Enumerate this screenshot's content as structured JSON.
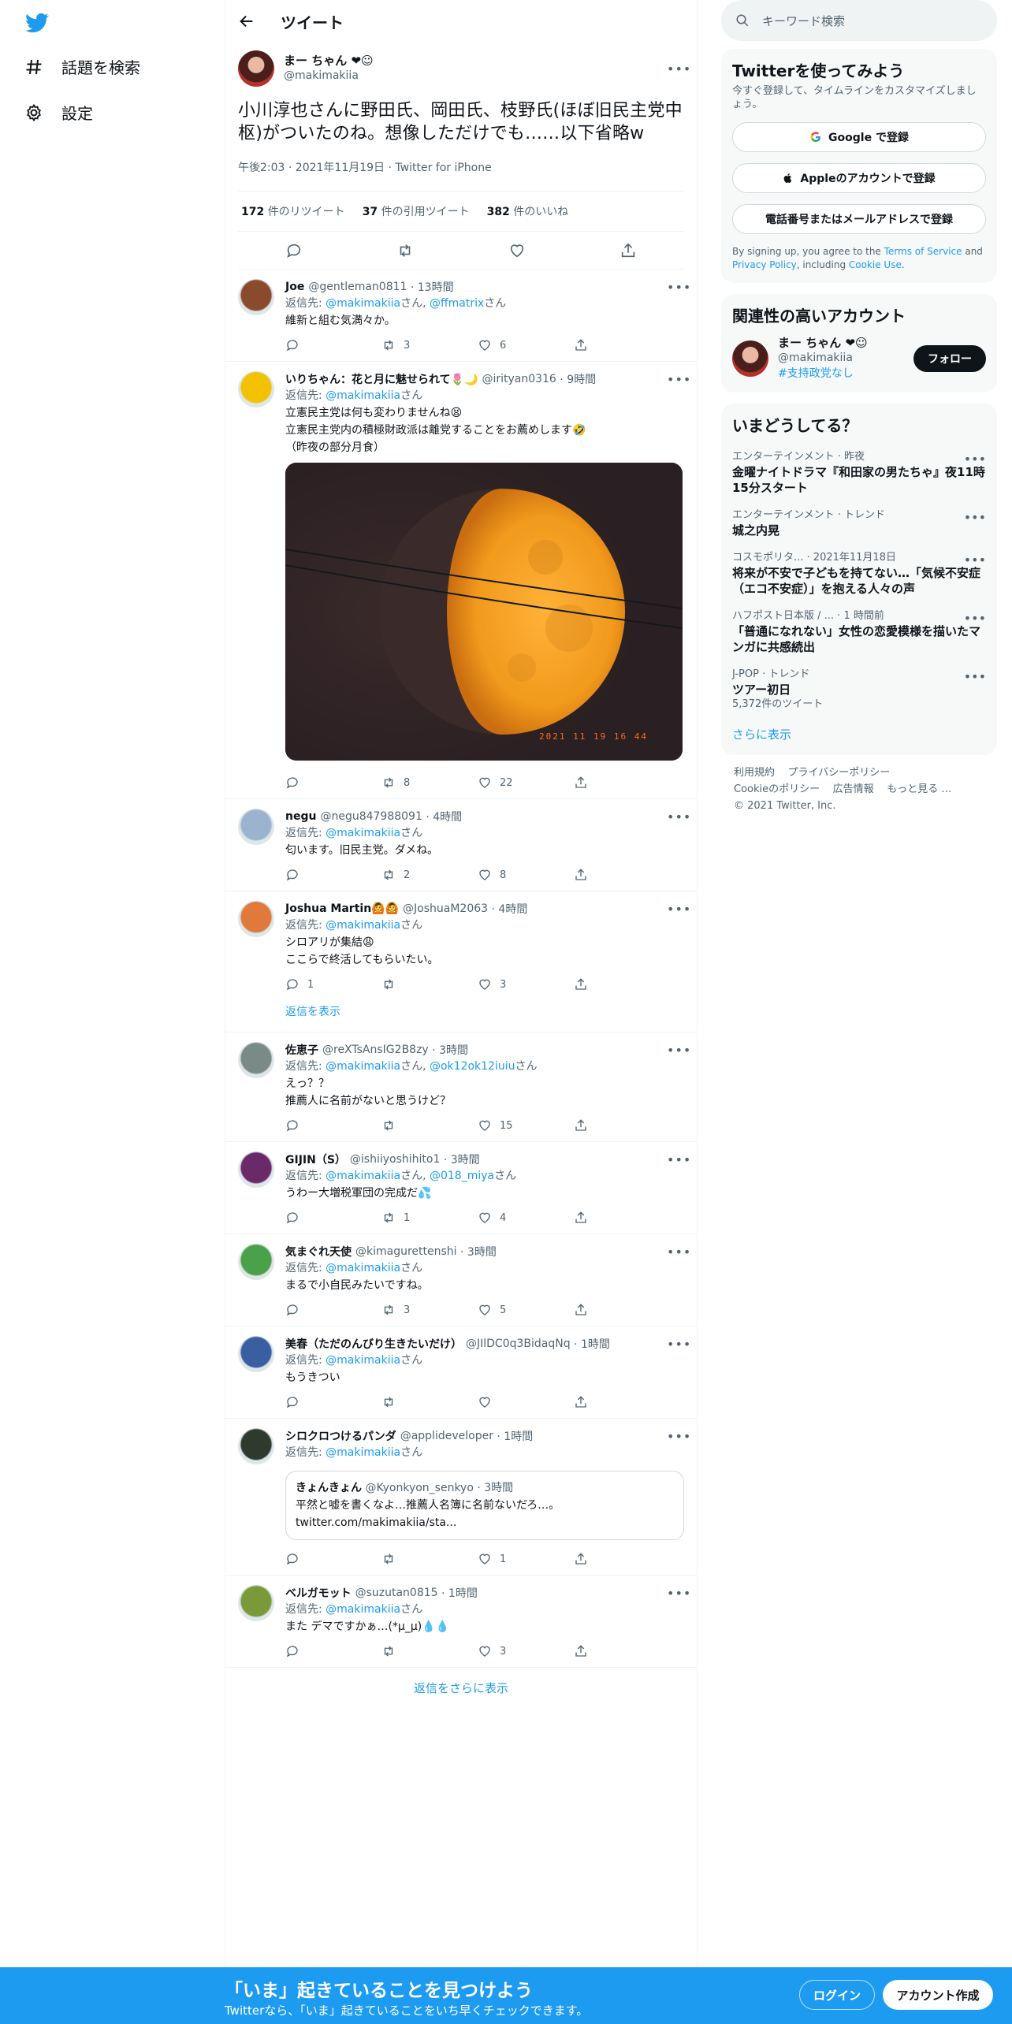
{
  "nav": {
    "explore_label": "話題を検索",
    "settings_label": "設定"
  },
  "header": {
    "title": "ツイート"
  },
  "focal": {
    "name": "まー ちゃん ❤☺",
    "handle": "@makimakiia",
    "text": "小川淳也さんに野田氏、岡田氏、枝野氏(ほぼ旧民主党中枢)がついたのね。想像しただけでも……以下省略w",
    "meta": "午後2:03 · 2021年11月19日 · Twitter for iPhone",
    "retweets": "172",
    "retweets_label": "件のリツイート",
    "quotes": "37",
    "quotes_label": "件の引用ツイート",
    "likes": "382",
    "likes_label": "件のいいね"
  },
  "replies": [
    {
      "name": "Joe",
      "handle": "@gentleman0811",
      "time": "· 13時間",
      "to": [
        "@makimakiia",
        "@ffmatrix"
      ],
      "text": "維新と組む気満々か。",
      "reply": "",
      "retweet": "3",
      "like": "6"
    },
    {
      "name": "いりちゃん：花と月に魅せられて🌷🌙",
      "handle": "@irityan0316",
      "time": "· 9時間",
      "to": [
        "@makimakiia"
      ],
      "text": "立憲民主党は何も変わりませんね😫\n立憲民主党内の積極財政派は離党することをお薦めします🤣\n（昨夜の部分月食）",
      "reply": "",
      "retweet": "8",
      "like": "22",
      "image_stamp": "2021 11 19  16 44"
    },
    {
      "name": "negu",
      "handle": "@negu847988091",
      "time": "· 4時間",
      "to": [
        "@makimakiia"
      ],
      "text": "匂います。旧民主党。ダメね。",
      "reply": "",
      "retweet": "2",
      "like": "8"
    },
    {
      "name": "Joshua Martin🙆🙆",
      "handle": "@JoshuaM2063",
      "time": "· 4時間",
      "to": [
        "@makimakiia"
      ],
      "text": "シロアリが集結😩\nここらで終活してもらいたい。",
      "reply": "1",
      "retweet": "",
      "like": "3",
      "show_replies": "返信を表示"
    },
    {
      "name": "佐恵子",
      "handle": "@reXTsAnsIG2B8zy",
      "time": "· 3時間",
      "to": [
        "@makimakiia",
        "@ok12ok12iuiu"
      ],
      "text": "えっ？？\n推薦人に名前がないと思うけど？",
      "reply": "",
      "retweet": "",
      "like": "15"
    },
    {
      "name": "GIJIN（S）",
      "handle": "@ishiiyoshihito1",
      "time": "· 3時間",
      "to": [
        "@makimakiia",
        "@018_miya"
      ],
      "text": "うわー大増税軍団の完成だ💦",
      "reply": "",
      "retweet": "1",
      "like": "4"
    },
    {
      "name": "気まぐれ天使",
      "handle": "@kimagurettenshi",
      "time": "· 3時間",
      "to": [
        "@makimakiia"
      ],
      "text": "まるで小自民みたいですね。",
      "reply": "",
      "retweet": "3",
      "like": "5"
    },
    {
      "name": "美春（ただのんびり生きたいだけ）",
      "handle": "@JIlDC0q3BidaqNq",
      "time": "· 1時間",
      "to": [
        "@makimakiia"
      ],
      "text": "もうきつい",
      "reply": "",
      "retweet": "",
      "like": ""
    },
    {
      "name": "シロクロつけるパンダ",
      "handle": "@applideveloper",
      "time": "· 1時間",
      "to": [
        "@makimakiia"
      ],
      "text": "",
      "reply": "",
      "retweet": "",
      "like": "1",
      "quote": {
        "name": "きょんきょん",
        "handle": "@Kyonkyon_senkyo",
        "time": "· 3時間",
        "text": "平然と嘘を書くなよ…推薦人名簿に名前ないだろ…。",
        "link": "twitter.com/makimakiia/sta..."
      }
    },
    {
      "name": "ベルガモット",
      "handle": "@suzutan0815",
      "time": "· 1時間",
      "to": [
        "@makimakiia"
      ],
      "text": "また デマですかぁ…(*µ_µ)💧💧",
      "reply": "",
      "retweet": "",
      "like": "3"
    }
  ],
  "reply_prefix": "返信先: ",
  "reply_suffix": "さん",
  "more_replies": "返信をさらに表示",
  "search": {
    "placeholder": "キーワード検索"
  },
  "signup": {
    "title": "Twitterを使ってみよう",
    "subtitle": "今すぐ登録して、タイムラインをカスタマイズしましょう。",
    "google": "Google で登録",
    "apple": "Appleのアカウントで登録",
    "phone": "電話番号またはメールアドレスで登録",
    "legal_1": "By signing up, you agree to the ",
    "tos": "Terms of Service",
    "legal_2": " and ",
    "privacy": "Privacy Policy",
    "legal_3": ", including ",
    "cookie": "Cookie Use",
    "legal_4": "."
  },
  "relevant": {
    "title": "関連性の高いアカウント",
    "name": "まー ちゃん ❤☺",
    "handle": "@makimakiia",
    "bio": "#支持政党なし",
    "follow": "フォロー"
  },
  "trends": {
    "title": "いまどうしてる？",
    "items": [
      {
        "cat": "エンターテインメント · 昨夜",
        "title": "金曜ナイトドラマ『和田家の男たちゃ』夜11時15分スタート",
        "count": ""
      },
      {
        "cat": "エンターテインメント · トレンド",
        "title": "城之内晃",
        "count": ""
      },
      {
        "cat": "コスモポリタ... · 2021年11月18日",
        "title": "将来が不安で子どもを持てない…「気候不安症（エコ不安症）」を抱える人々の声",
        "count": ""
      },
      {
        "cat": "ハフポスト日本版 / ... · 1 時間前",
        "title": "「普通になれない」女性の恋愛模様を描いたマンガに共感続出",
        "count": ""
      },
      {
        "cat": "J-POP · トレンド",
        "title": "ツアー初日",
        "count": "5,372件のツイート"
      }
    ],
    "more": "さらに表示"
  },
  "footer": {
    "terms": "利用規約",
    "privacy": "プライバシーポリシー",
    "cookie": "Cookieのポリシー",
    "ads": "広告情報",
    "more": "もっと見る …",
    "copy": "© 2021 Twitter, Inc."
  },
  "banner": {
    "title": "「いま」起きていることを見つけよう",
    "subtitle": "Twitterなら、「いま」起きていることをいち早くチェックできます。",
    "login": "ログイン",
    "signup": "アカウント作成"
  },
  "colors": {
    "accent": "#1d9bf0",
    "text": "#0f1419",
    "muted": "#536471"
  }
}
